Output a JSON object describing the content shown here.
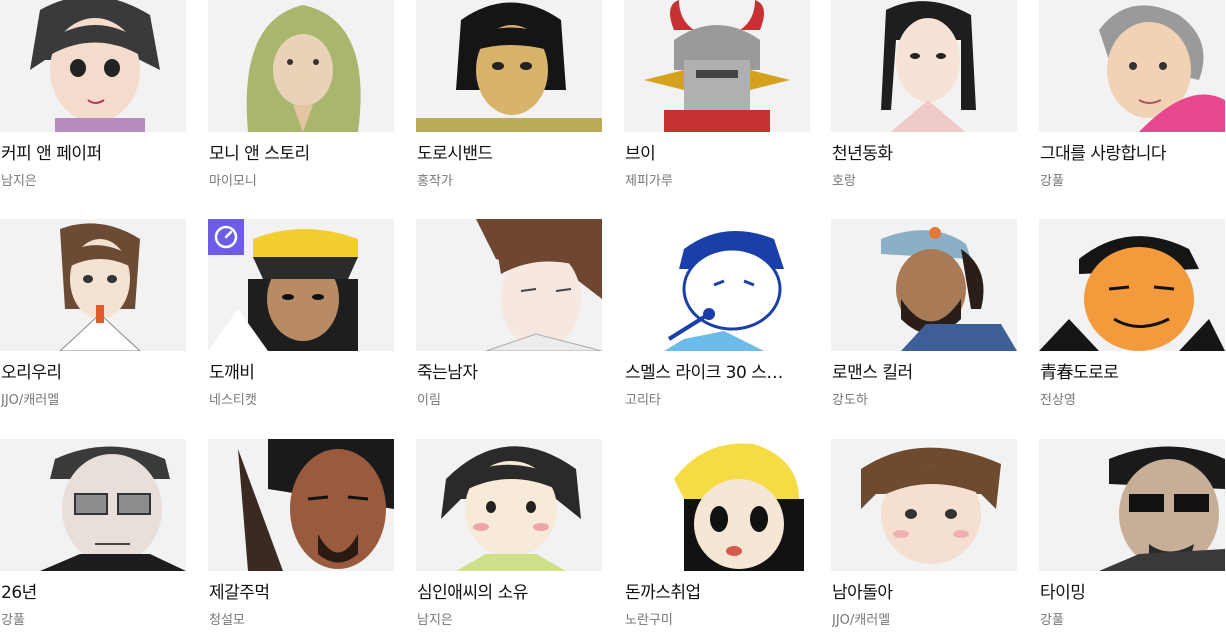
{
  "webtoons": [
    {
      "title": "커피 앤 페이퍼",
      "author": "남지은",
      "thumb_icon": "girl-bob-hair-thumbnail"
    },
    {
      "title": "모니 앤 스토리",
      "author": "마이모니",
      "thumb_icon": "hooded-doll-thumbnail"
    },
    {
      "title": "도로시밴드",
      "author": "홍작가",
      "thumb_icon": "short-black-hair-woman-thumbnail"
    },
    {
      "title": "브이",
      "author": "제피가루",
      "thumb_icon": "horned-robot-thumbnail"
    },
    {
      "title": "천년동화",
      "author": "호랑",
      "thumb_icon": "hanbok-girl-thumbnail"
    },
    {
      "title": "그대를 사랑합니다",
      "author": "강풀",
      "thumb_icon": "grandmother-thumbnail"
    },
    {
      "title": "오리우리",
      "author": "JJO/캐러멜",
      "thumb_icon": "brown-hair-girl-thumbnail"
    },
    {
      "title": "도깨비",
      "author": "네스티캣",
      "thumb_icon": "capped-boy-thumbnail",
      "badge_icon": "clock-badge-icon",
      "badge_color": "#6e5ce6"
    },
    {
      "title": "죽는남자",
      "author": "이림",
      "thumb_icon": "long-bangs-man-thumbnail"
    },
    {
      "title": "스멜스 라이크 30 스…",
      "author": "고리타",
      "thumb_icon": "singing-man-thumbnail"
    },
    {
      "title": "로맨스 킬러",
      "author": "강도하",
      "thumb_icon": "bearded-man-cap-thumbnail"
    },
    {
      "title": "青春도로로",
      "author": "전상영",
      "thumb_icon": "smiling-tanned-man-thumbnail"
    },
    {
      "title": "26년",
      "author": "강풀",
      "thumb_icon": "glasses-man-thumbnail"
    },
    {
      "title": "제갈주먹",
      "author": "청설모",
      "thumb_icon": "scarred-warrior-thumbnail"
    },
    {
      "title": "심인애씨의 소유",
      "author": "남지은",
      "thumb_icon": "blushing-girl-thumbnail"
    },
    {
      "title": "돈까스취업",
      "author": "노란구미",
      "thumb_icon": "yellow-hat-girl-thumbnail"
    },
    {
      "title": "남아돌아",
      "author": "JJO/캐러멜",
      "thumb_icon": "shaggy-hair-boy-thumbnail"
    },
    {
      "title": "타이밍",
      "author": "강풀",
      "thumb_icon": "sunglasses-man-thumbnail"
    }
  ]
}
